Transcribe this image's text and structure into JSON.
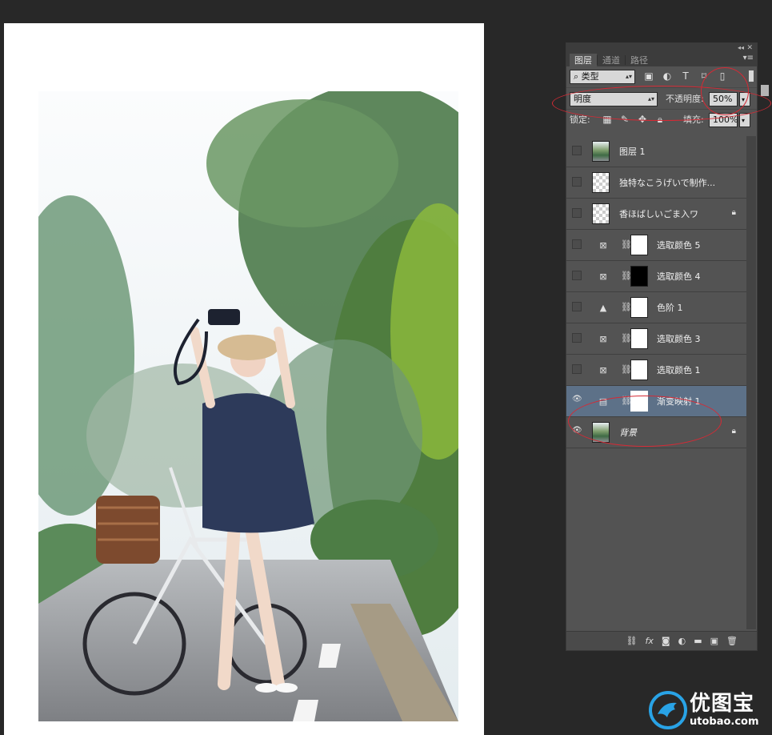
{
  "panel": {
    "tabs": [
      {
        "label": "图层",
        "active": true
      },
      {
        "label": "通道",
        "active": false
      },
      {
        "label": "路径",
        "active": false
      }
    ],
    "collapse_icon": "double-chevron-left-icon",
    "close_icon": "close-icon",
    "menu_icon": "panel-menu-icon",
    "filter_kind": "类型",
    "blend_mode": "明度",
    "opacity_label": "不透明度:",
    "opacity_value": "50%",
    "lock_label": "锁定:",
    "fill_label": "填充:",
    "fill_value": "100%"
  },
  "layers": [
    {
      "name": "图层 1",
      "visible": false,
      "thumb": "photo"
    },
    {
      "name": "独特なこうげいで制作...",
      "visible": false,
      "thumb": "transparent"
    },
    {
      "name": "香ほばしいごま入ワ",
      "visible": false,
      "thumb": "transparent",
      "locked": true
    },
    {
      "name": "选取颜色 5",
      "visible": false,
      "adjustment": "selective-color",
      "mask": "white"
    },
    {
      "name": "选取颜色 4",
      "visible": false,
      "adjustment": "selective-color",
      "mask": "dark"
    },
    {
      "name": "色阶 1",
      "visible": false,
      "adjustment": "levels",
      "mask": "white"
    },
    {
      "name": "选取颜色 3",
      "visible": false,
      "adjustment": "selective-color",
      "mask": "white"
    },
    {
      "name": "选取颜色 1",
      "visible": false,
      "adjustment": "selective-color",
      "mask": "white"
    },
    {
      "name": "渐变映射 1",
      "visible": true,
      "adjustment": "gradient-map",
      "mask": "white",
      "selected": true
    },
    {
      "name": "背景",
      "visible": true,
      "thumb": "photo",
      "locked": true
    }
  ],
  "watermark": {
    "name": "优图宝",
    "url": "utobao.com"
  },
  "colors": {
    "annotation": "#d52a35",
    "selected_layer": "#5d7188",
    "panel_bg": "#535353"
  }
}
